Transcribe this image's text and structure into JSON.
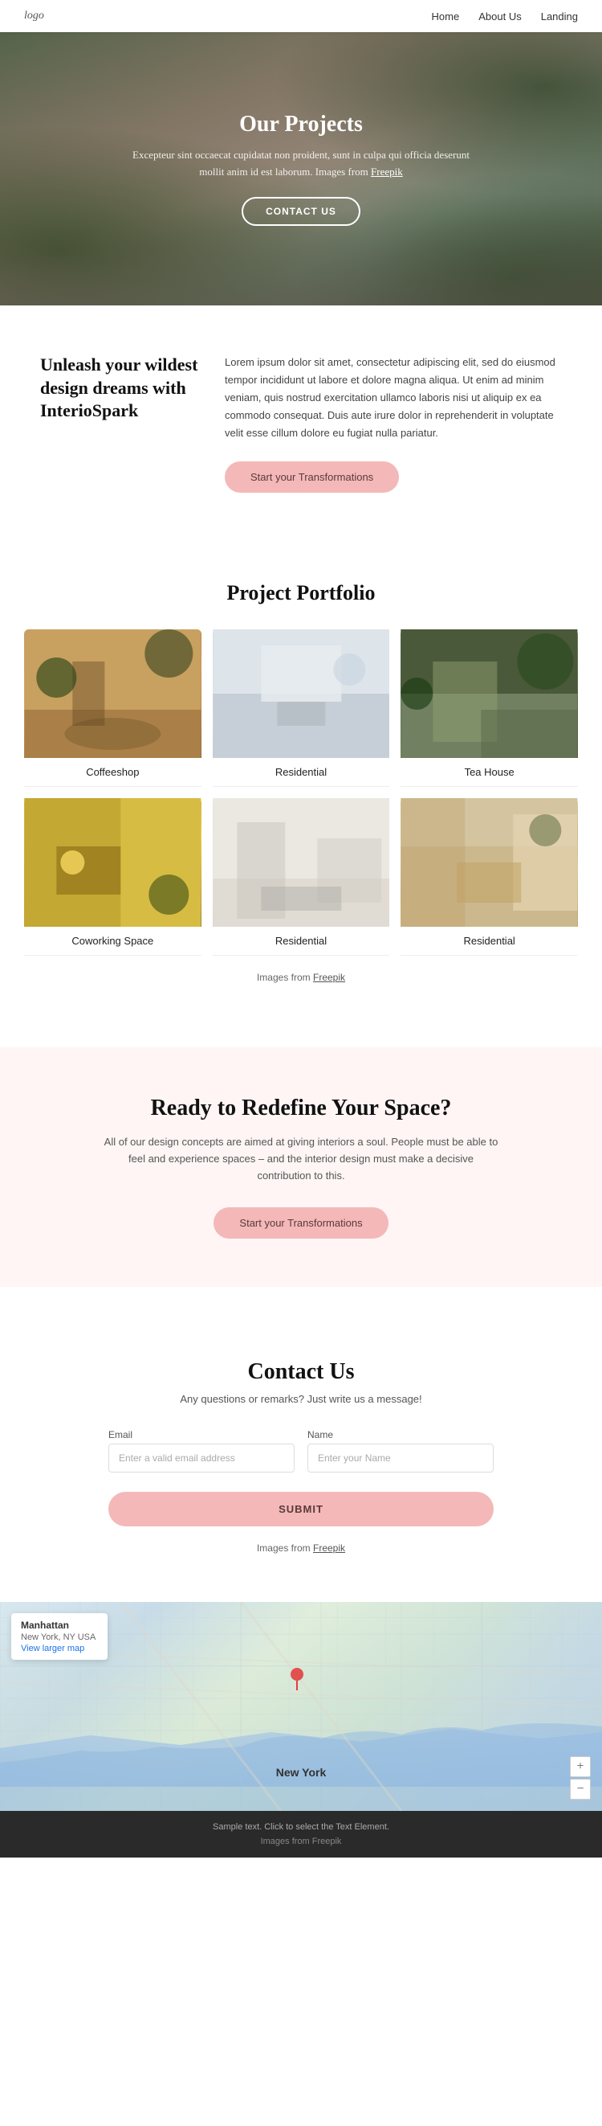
{
  "nav": {
    "logo": "logo",
    "links": [
      {
        "label": "Home",
        "href": "#"
      },
      {
        "label": "About Us",
        "href": "#"
      },
      {
        "label": "Landing",
        "href": "#"
      }
    ]
  },
  "hero": {
    "title": "Our Projects",
    "description": "Excepteur sint occaecat cupidatat non proident, sunt in culpa qui officia deserunt mollit anim id est laborum. Images from ",
    "freepik_link": "Freepik",
    "contact_button": "CONTACT US"
  },
  "about": {
    "heading": "Unleash your wildest design dreams with InterioSpark",
    "body": "Lorem ipsum dolor sit amet, consectetur adipiscing elit, sed do eiusmod tempor incididunt ut labore et dolore magna aliqua. Ut enim ad minim veniam, quis nostrud exercitation ullamco laboris nisi ut aliquip ex ea commodo consequat. Duis aute irure dolor in reprehenderit in voluptate velit esse cillum dolore eu fugiat nulla pariatur.",
    "button": "Start your Transformations"
  },
  "portfolio": {
    "title": "Project Portfolio",
    "items": [
      {
        "label": "Coffeeshop",
        "img_class": "img-coffeeshop"
      },
      {
        "label": "Residential",
        "img_class": "img-residential1"
      },
      {
        "label": "Tea House",
        "img_class": "img-teahouse"
      },
      {
        "label": "Coworking Space",
        "img_class": "img-coworking"
      },
      {
        "label": "Residential",
        "img_class": "img-residential2"
      },
      {
        "label": "Residential",
        "img_class": "img-residential3"
      }
    ],
    "footer_text": "Images from ",
    "footer_link": "Freepik"
  },
  "cta": {
    "title": "Ready to Redefine Your Space?",
    "description": "All of our design concepts are aimed at giving interiors a soul. People must be able to feel and experience spaces – and the interior design must make a decisive contribution to this.",
    "button": "Start your Transformations"
  },
  "contact": {
    "title": "Contact Us",
    "subtitle": "Any questions or remarks? Just write us a message!",
    "email_label": "Email",
    "email_placeholder": "Enter a valid email address",
    "name_label": "Name",
    "name_placeholder": "Enter your Name",
    "submit_button": "SUBMIT",
    "footer_text": "Images from ",
    "footer_link": "Freepik"
  },
  "map": {
    "city": "Manhattan",
    "address": "New York, NY USA",
    "view_link": "View larger map",
    "label": "New York",
    "zoom_in": "+",
    "zoom_out": "−"
  },
  "footer": {
    "sample_text": "Sample text. Click to select the Text Element.",
    "images_text": "Images from ",
    "freepik_link": "Freepik"
  }
}
